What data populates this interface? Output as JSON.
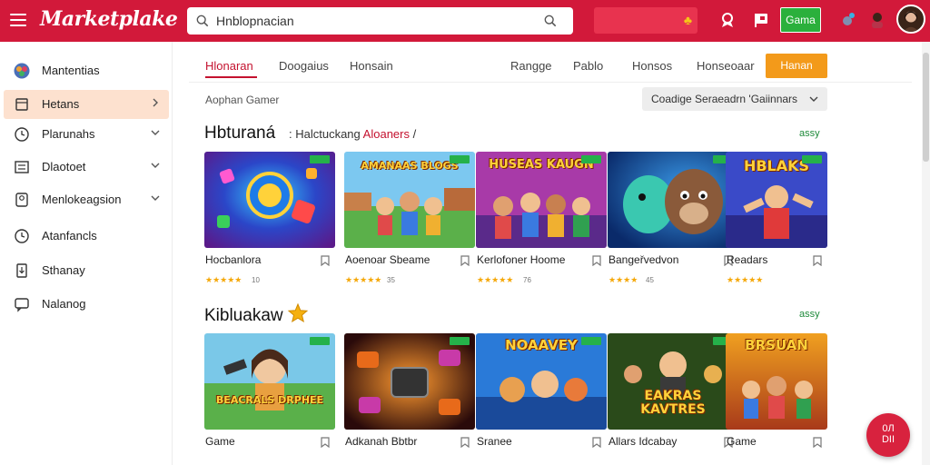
{
  "header": {
    "logo": "Marketplake",
    "search_value": "Hnblopnacian",
    "game_button": "Gama"
  },
  "sidebar": {
    "items": [
      {
        "label": "Mantentias",
        "icon": "apps-icon"
      },
      {
        "label": "Hetans",
        "icon": "tag-icon"
      },
      {
        "label": "Plarunahs",
        "icon": "clock-icon"
      },
      {
        "label": "Dlaotoet",
        "icon": "list-icon"
      },
      {
        "label": "Menlokeagsion",
        "icon": "user-icon"
      },
      {
        "label": "Atanfancls",
        "icon": "clock-icon"
      },
      {
        "label": "Sthanay",
        "icon": "download-icon"
      },
      {
        "label": "Nalanog",
        "icon": "chat-icon"
      }
    ]
  },
  "tabs": [
    "Hlonaran",
    "Doogaius",
    "Honsain",
    "Rangge",
    "Pablo",
    "Honsos",
    "Honseoaar"
  ],
  "cta_label": "Hanan",
  "filter_label": "Aophan Gamer",
  "sort_label": "Coadige Seraeadrn 'Gaiinnars",
  "sections": [
    {
      "title": "Hbturaná",
      "subtitle_prefix": ": Halctuckang",
      "subtitle_highlight": "Aloaners",
      "subtitle_suffix": "/",
      "link": "assy",
      "cards": [
        {
          "name": "Hocbanlora",
          "rating": "10",
          "art_text": ""
        },
        {
          "name": "Aoenoar Sbeame",
          "rating": "35",
          "art_text": "AMANAAS BLOGS"
        },
        {
          "name": "Kerlofoner Hoome",
          "rating": "76",
          "art_text": "HUSEAS KAUGN"
        },
        {
          "name": "Bangeřvedvon",
          "rating": "45",
          "art_text": ""
        },
        {
          "name": "Readars",
          "rating": "",
          "art_text": "HBLAKS"
        }
      ]
    },
    {
      "title": "Kibluakaw",
      "subtitle_prefix": "",
      "subtitle_highlight": "",
      "subtitle_suffix": "",
      "link": "assy",
      "cards": [
        {
          "name": "Game",
          "rating": "",
          "art_text": "BEACRALS DRPHEE"
        },
        {
          "name": "Adkanah Bbtbr",
          "rating": "",
          "art_text": ""
        },
        {
          "name": "Sranee",
          "rating": "",
          "art_text": "NOAAVEY"
        },
        {
          "name": "Allars Idcabay",
          "rating": "",
          "art_text": "EAKRAS KAVTRES"
        },
        {
          "name": "Game",
          "rating": "",
          "art_text": "BRSUAN"
        }
      ]
    }
  ],
  "fab_label": "0Л\nDII",
  "colors": {
    "brand": "#d2193a",
    "accent_orange": "#f39a1a",
    "success_green": "#2bb03c",
    "star": "#f5a80a"
  }
}
